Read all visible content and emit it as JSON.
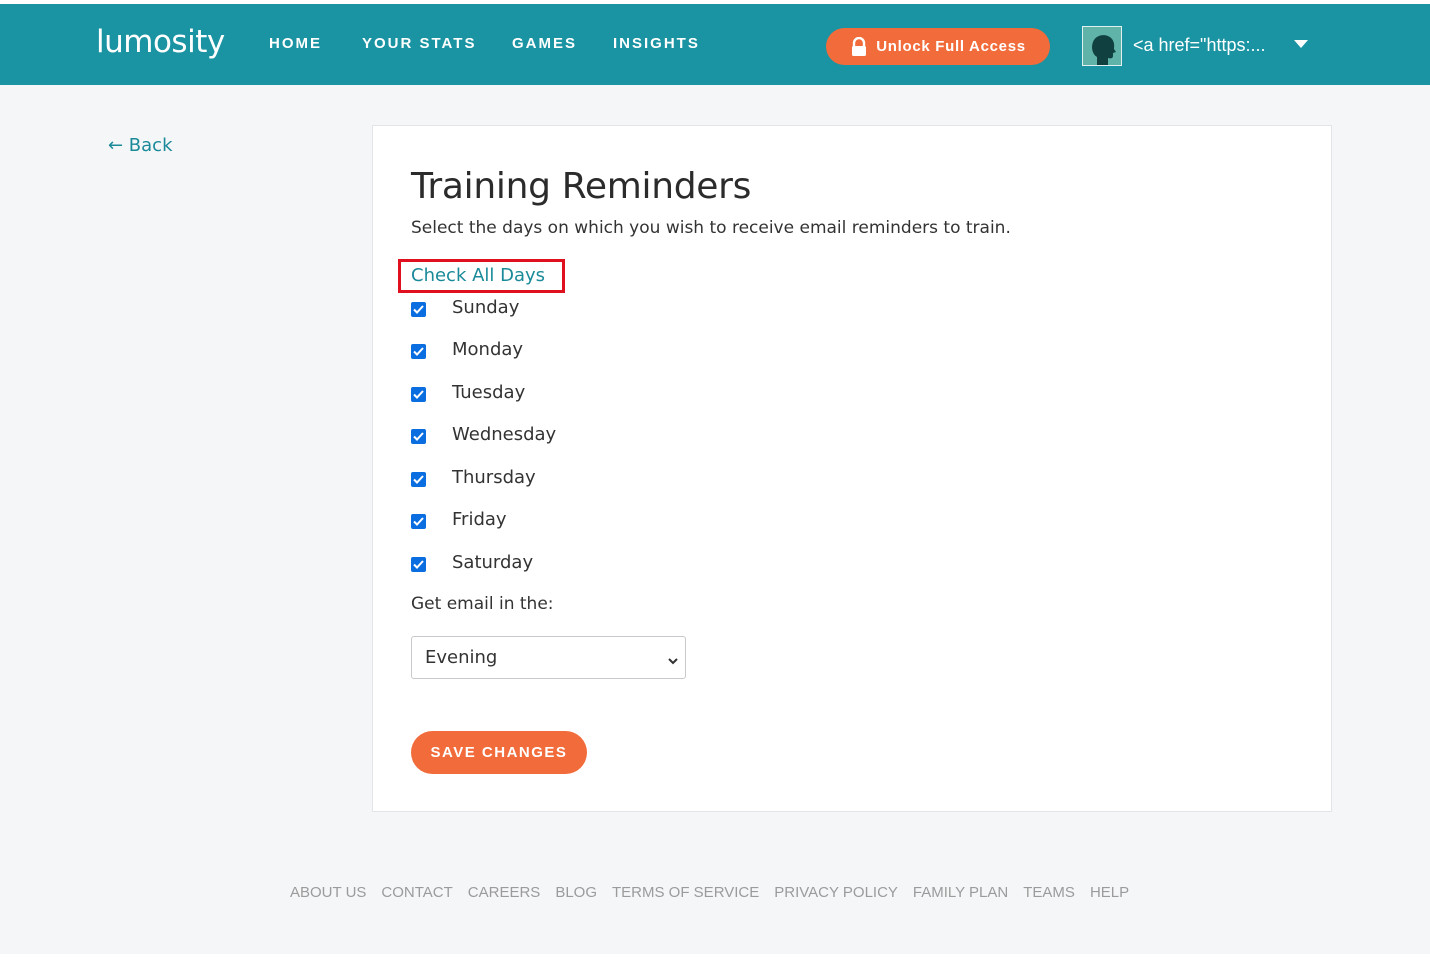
{
  "header": {
    "logo": "lumosity",
    "nav": [
      {
        "label": "HOME"
      },
      {
        "label": "YOUR STATS"
      },
      {
        "label": "GAMES"
      },
      {
        "label": "INSIGHTS"
      }
    ],
    "unlock_label": "Unlock Full Access",
    "user_name": "<a href=\"https:...",
    "avatar_icon": "head-silhouette-icon"
  },
  "back_label": "← Back",
  "card": {
    "title": "Training Reminders",
    "subtitle": "Select the days on which you wish to receive email reminders to train.",
    "check_all_label": "Check All Days",
    "days": [
      {
        "label": "Sunday",
        "checked": true
      },
      {
        "label": "Monday",
        "checked": true
      },
      {
        "label": "Tuesday",
        "checked": true
      },
      {
        "label": "Wednesday",
        "checked": true
      },
      {
        "label": "Thursday",
        "checked": true
      },
      {
        "label": "Friday",
        "checked": true
      },
      {
        "label": "Saturday",
        "checked": true
      }
    ],
    "email_time_label": "Get email in the:",
    "email_time_value": "Evening",
    "save_label": "SAVE CHANGES"
  },
  "footer": {
    "links": [
      "ABOUT US",
      "CONTACT",
      "CAREERS",
      "BLOG",
      "TERMS OF SERVICE",
      "PRIVACY POLICY",
      "FAMILY PLAN",
      "TEAMS",
      "HELP"
    ]
  },
  "colors": {
    "header_bg": "#1a93a2",
    "accent_orange": "#f26b3a",
    "link_teal": "#1a8a99",
    "checkbox_blue": "#0a6ee0",
    "highlight_red": "#e0101f"
  }
}
